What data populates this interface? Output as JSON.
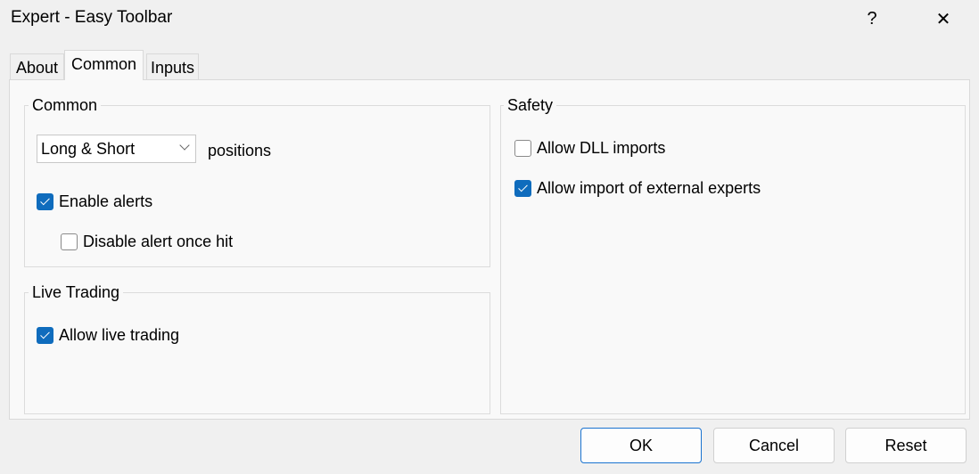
{
  "window": {
    "title": "Expert - Easy Toolbar",
    "help": "?",
    "close": "✕"
  },
  "tabs": [
    {
      "label": "About"
    },
    {
      "label": "Common",
      "active": true
    },
    {
      "label": "Inputs"
    }
  ],
  "common": {
    "label": "Common",
    "positions_value": "Long & Short",
    "positions_label": "positions",
    "enable_alerts": {
      "label": "Enable alerts",
      "checked": true
    },
    "disable_alert": {
      "label": "Disable alert once hit",
      "checked": false
    }
  },
  "live": {
    "label": "Live Trading",
    "allow_live": {
      "label": "Allow live trading",
      "checked": true
    }
  },
  "safety": {
    "label": "Safety",
    "dll": {
      "label": "Allow DLL imports",
      "checked": false
    },
    "external": {
      "label": "Allow import of external experts",
      "checked": true
    }
  },
  "buttons": {
    "ok": "OK",
    "cancel": "Cancel",
    "reset": "Reset"
  },
  "colors": {
    "accent": "#0f6cbd"
  }
}
